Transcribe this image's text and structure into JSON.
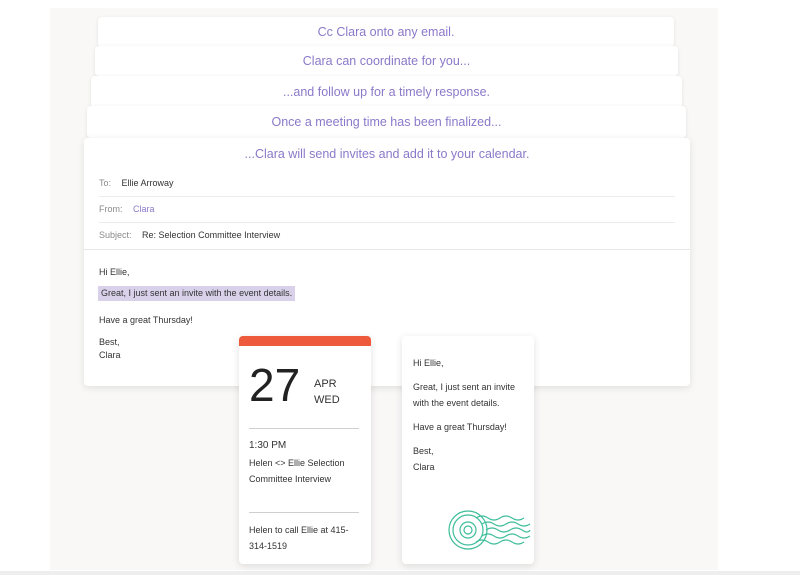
{
  "stack": {
    "step1": "Cc Clara onto any email.",
    "step2": "Clara can coordinate for you...",
    "step3": "...and follow up for a timely response.",
    "step4": "Once a meeting time has been finalized...",
    "step5": "...Clara will send invites and add it to your calendar."
  },
  "email": {
    "to_label": "To:",
    "to_value": "Ellie Arroway",
    "from_label": "From:",
    "from_value": "Clara",
    "subject_label": "Subject:",
    "subject_value": "Re: Selection Committee Interview",
    "greeting": "Hi Ellie,",
    "highlight": "Great, I just sent an invite with the event details.",
    "thursday": "Have a great Thursday!",
    "best": "Best,",
    "signature": "Clara"
  },
  "calendar": {
    "day": "27",
    "month": "APR",
    "weekday": "WED",
    "time": "1:30 PM",
    "title": "Helen <> Ellie Selection Committee Interview",
    "note": "Helen to call Ellie at 415-314-1519",
    "accent": "#ed5a3c"
  },
  "letter": {
    "greeting": "Hi Ellie,",
    "body": "Great, I just sent an invite with the event details.",
    "thursday": "Have a great Thursday!",
    "best": "Best,",
    "signature": "Clara",
    "stamp_icon": "postmark-stamp-icon",
    "stamp_color": "#3dbd9a"
  },
  "colors": {
    "brand_purple": "#8b79c9",
    "highlight": "#d9d1ea"
  }
}
